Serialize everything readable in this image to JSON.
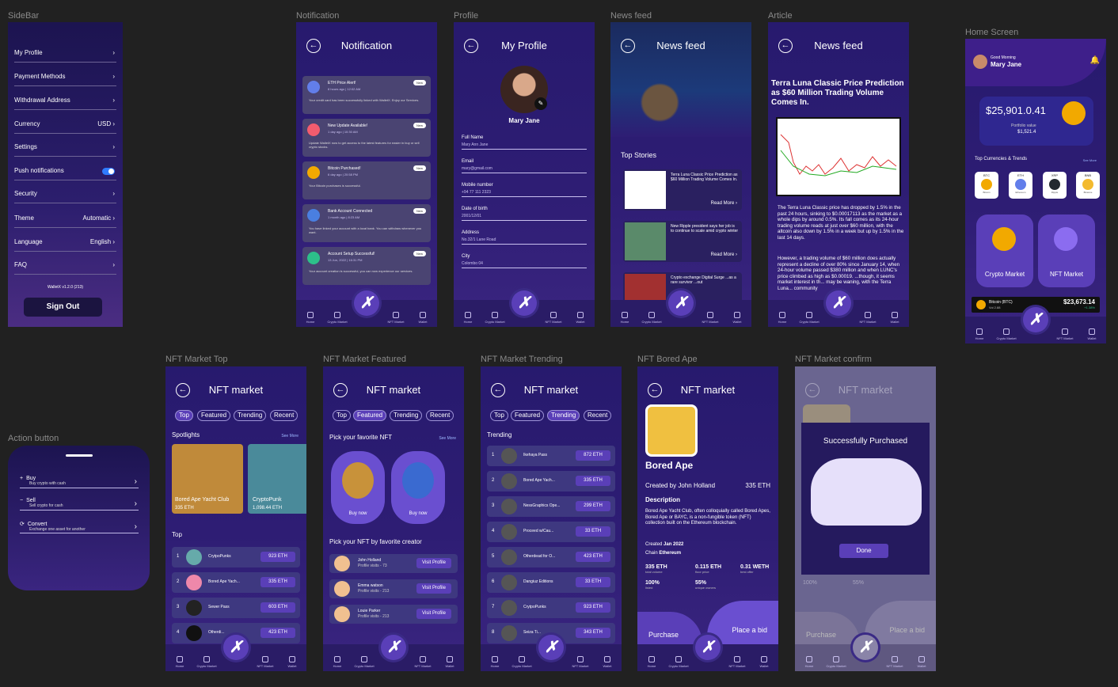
{
  "labels": {
    "sidebar": "SideBar",
    "notification": "Notification",
    "profile": "Profile",
    "newsfeed": "News feed",
    "article": "Article",
    "home": "Home Screen",
    "action": "Action button",
    "nft_top": "NFT Market Top",
    "nft_featured": "NFT Market Featured",
    "nft_trending": "NFT Market Trending",
    "nft_ape": "NFT Bored Ape",
    "nft_confirm": "NFT Market confirm"
  },
  "sidebar": {
    "items": [
      {
        "label": "My Profile",
        "value": "›"
      },
      {
        "label": "Payment Methods",
        "value": "›"
      },
      {
        "label": "Withdrawal Address",
        "value": "›"
      },
      {
        "label": "Currency",
        "value": "USD ›"
      },
      {
        "label": "Settings",
        "value": "›"
      },
      {
        "label": "Push notifications",
        "value": ""
      },
      {
        "label": "Security",
        "value": "›"
      },
      {
        "label": "Theme",
        "value": "Automatic ›"
      },
      {
        "label": "Language",
        "value": "English ›"
      },
      {
        "label": "FAQ",
        "value": "›"
      }
    ],
    "version": "WalletX v1.2.0 (213)",
    "signout": "Sign Out"
  },
  "nav": {
    "home": "Home",
    "crypto": "Crypto Market",
    "nft": "NFT Market",
    "wallet": "Wallet",
    "fab": "✗"
  },
  "notification": {
    "title": "Notification",
    "cards": [
      {
        "title": "ETH Price Alert!",
        "sub": "8 hours ago | 12:02 AM",
        "desc": "Your credit card has been successfully linked with WalletX. Enjoy our Services.",
        "badge": "New",
        "color": "#627eea"
      },
      {
        "title": "New Update Available!",
        "sub": "1 day ago | 10:30 AM",
        "desc": "Update WalletX now to get access to the latest features for easier in buy or sell crypto stocks.",
        "badge": "New",
        "color": "#f25c6e"
      },
      {
        "title": "Bitcoin Purchased!",
        "sub": "6 day ago | 20:58 PM",
        "desc": "Your Bitcoin purchases is successful.",
        "badge": "New",
        "color": "#f2a900"
      },
      {
        "title": "Bank Account Connected",
        "sub": "1 month ago | 8:23 AM",
        "desc": "You have linked your account with a local bank. You can withdraw whenever you want.",
        "badge": "New",
        "color": "#4a7fe0"
      },
      {
        "title": "Account Setup Successful!",
        "sub": "13 Jun, 2022 | 16:31 PM",
        "desc": "Your account creation is successful, you can now experience our services.",
        "badge": "New",
        "color": "#2dbf8a"
      }
    ]
  },
  "profile": {
    "title": "My Profile",
    "name": "Mary Jane",
    "fields": [
      {
        "label": "Full Name",
        "value": "Mary Ann Jane"
      },
      {
        "label": "Email",
        "value": "mary@gmail.com"
      },
      {
        "label": "Mobile number",
        "value": "+94 77 111 2323"
      },
      {
        "label": "Date of birth",
        "value": "2001/12/01"
      },
      {
        "label": "Address",
        "value": "No.32/1 Lane Road"
      },
      {
        "label": "City",
        "value": "Colombo 04"
      }
    ]
  },
  "newsfeed": {
    "title": "News feed",
    "section": "Top Stories",
    "stories": [
      {
        "text": "Terra Luna Classic Price Prediction as $60 Million Trading Volume Comes In.",
        "more": "Read More ›"
      },
      {
        "text": "New Ripple president says her job is to continue to scale amid crypto winter",
        "more": "Read More ›"
      },
      {
        "text": "Crypto exchange Digital Surge ...as a rare survivor ...out",
        "more": ""
      }
    ]
  },
  "article": {
    "title": "News feed",
    "headline": "Terra Luna Classic Price Prediction as $60 Million Trading Volume Comes In.",
    "p1": "The Terra Luna Classic price has dropped by 1.5% in the past 24 hours, sinking to $0.00017113 as the market as a whole dips by around 0.5%. Its fall comes as its 24-hour trading volume reads at just over $60 million, with the altcoin also down by 1.5% in a week but up by 1.5% in the last 14 days.",
    "p2": "However, a trading volume of $60 million does actually represent a decline of over 80% since January 14, when 24-hour volume passed $380 million and when LUNC's price climbed as high as $0.00019. ...though, it seems market interest in th... may be waning, with the Terra Luna... community"
  },
  "home": {
    "greet": "Good Morning",
    "name": "Mary Jane",
    "balance": "$25,901.0.41",
    "pv": "Portfolio value",
    "pvv": "$1,521.4",
    "section": "Top Currencies & Trends",
    "see": "See More",
    "coins": [
      {
        "code": "BTC",
        "name": "Bitcoin",
        "color": "#f2a900"
      },
      {
        "code": "ETH",
        "name": "Ethereum",
        "color": "#627eea"
      },
      {
        "code": "XRP",
        "name": "Ripple",
        "color": "#23292f"
      },
      {
        "code": "BNB",
        "name": "Binance",
        "color": "#f3ba2f"
      }
    ],
    "cards": [
      "Crypto Market",
      "NFT Market"
    ],
    "ticker": {
      "name": "Bitcoin (BTC)",
      "vol": "Vol 2.88",
      "price": "$23,673.14",
      "change": "+1.38%",
      "partial": "$23 95"
    }
  },
  "action": {
    "items": [
      {
        "label": "Buy",
        "sub": "Buy crypto with cash",
        "icon": "+"
      },
      {
        "label": "Sell",
        "sub": "Sell crypto for cash",
        "icon": "−"
      },
      {
        "label": "Convert",
        "sub": "Exchange one asset for another",
        "icon": "⟳"
      }
    ]
  },
  "nft": {
    "title": "NFT market",
    "tabs": [
      "Top",
      "Featured",
      "Trending",
      "Recent"
    ],
    "spotlights": "Spotlights",
    "see": "See More",
    "spot": [
      {
        "name": "Bored Ape Yacht Club",
        "price": "335 ETH"
      },
      {
        "name": "CryptoPunk",
        "price": "1,098.44 ETH"
      }
    ],
    "top": "Top",
    "toprows": [
      {
        "n": "1",
        "name": "CrytpoPunks",
        "price": "923 ETH",
        "color": "#6aa"
      },
      {
        "n": "2",
        "name": "Bored Ape Yach...",
        "price": "335 ETH",
        "color": "#e8a"
      },
      {
        "n": "3",
        "name": "Sewer Pass",
        "price": "603 ETH",
        "color": "#222"
      },
      {
        "n": "4",
        "name": "Otherdi...",
        "price": "423 ETH",
        "color": "#111"
      }
    ],
    "pick": "Pick your favorite NFT",
    "buy": "Buy now",
    "pick2": "Pick your NFT by favorite creator",
    "creators": [
      {
        "name": "John Holland",
        "visits": "Profile visits - 73",
        "btn": "Visit Profile"
      },
      {
        "name": "Emma watson",
        "visits": "Profile visits - 213",
        "btn": "Visit Profile"
      },
      {
        "name": "Louie Parker",
        "visits": "Profile visits - 213",
        "btn": "Visit Profile"
      }
    ],
    "trending": "Trending",
    "trend": [
      {
        "n": "1",
        "name": "Ikehaya Pass",
        "price": "872 ETH"
      },
      {
        "n": "2",
        "name": "Bored Ape Yach...",
        "price": "335 ETH"
      },
      {
        "n": "3",
        "name": "NessGraphics Ope...",
        "price": "299 ETH"
      },
      {
        "n": "4",
        "name": "Proceed w/Cau...",
        "price": "33 ETH"
      },
      {
        "n": "5",
        "name": "Otherdead for O...",
        "price": "423 ETH"
      },
      {
        "n": "6",
        "name": "Dangiuz Editions",
        "price": "33 ETH"
      },
      {
        "n": "7",
        "name": "CrytpoPunks",
        "price": "923 ETH"
      },
      {
        "n": "8",
        "name": "Seiza Ti...",
        "price": "343 ETH"
      }
    ]
  },
  "ape": {
    "title": "NFT market",
    "name": "Bored Ape",
    "created": "Created by",
    "creator": "John Holland",
    "price": "335 ETH",
    "desc_h": "Description",
    "desc": "Bored Ape Yacht Club, often colloquially called Bored Apes, Bored Ape or BAYC, is a non-fungible token (NFT) collection built on the Ethereum blockchain.",
    "created_on": "Created",
    "date": "Jan 2022",
    "chain_l": "Chain",
    "chain": "Ethereum",
    "stats": [
      {
        "v": "335 ETH",
        "l": "total volume"
      },
      {
        "v": "0.115 ETH",
        "l": "floor price"
      },
      {
        "v": "0.31 WETH",
        "l": "best offer"
      },
      {
        "v": "100%",
        "l": "listed"
      },
      {
        "v": "55%",
        "l": "unique owners"
      }
    ],
    "purchase": "Purchase",
    "bid": "Place a bid"
  },
  "confirm": {
    "title": "NFT market",
    "msg": "Successfully Purchased",
    "done": "Done",
    "purchase": "Purchase",
    "bid": "Place a bid",
    "s1": "100%",
    "s2": "55%"
  }
}
